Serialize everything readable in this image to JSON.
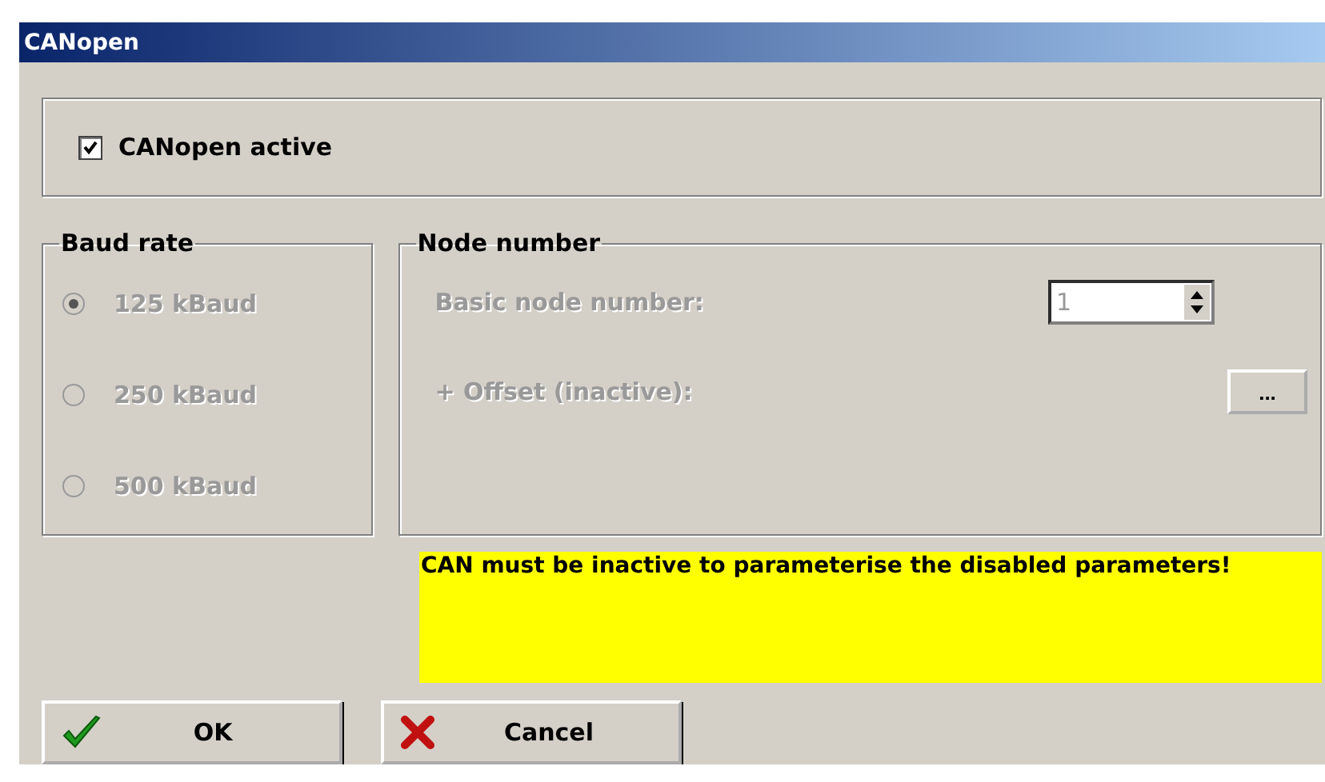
{
  "window": {
    "title": "CANopen"
  },
  "canopen_active": {
    "label": "CANopen active",
    "checked": true
  },
  "baud_rate": {
    "title": "Baud rate",
    "disabled": true,
    "options": [
      {
        "label": "125 kBaud",
        "selected": true
      },
      {
        "label": "250 kBaud",
        "selected": false
      },
      {
        "label": "500 kBaud",
        "selected": false
      }
    ]
  },
  "node_number": {
    "title": "Node number",
    "disabled": true,
    "basic_label": "Basic node number:",
    "basic_value": "1",
    "offset_label": "+ Offset (inactive):",
    "offset_button": "..."
  },
  "notice": "CAN must be inactive to parameterise the disabled parameters!",
  "buttons": [
    {
      "kind": "ok",
      "label": "OK"
    },
    {
      "kind": "cancel",
      "label": "Cancel"
    }
  ]
}
